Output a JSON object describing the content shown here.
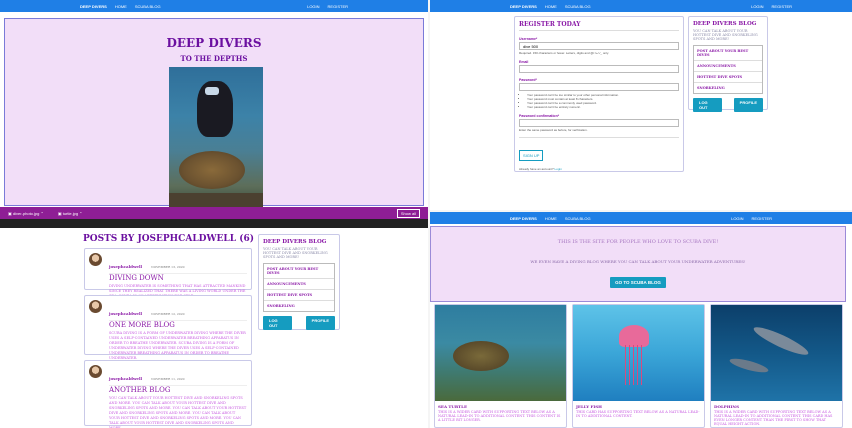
{
  "q1": {
    "nav": {
      "brand": "Deep Divers",
      "links": [
        "Home",
        "Scuba Blog"
      ],
      "right": [
        "Login",
        "Register"
      ]
    },
    "title": "Deep Divers",
    "subtitle": "To the Depths",
    "downloads": [
      "diver-photo.jpg",
      "turtle.jpg"
    ],
    "show_all": "Show all"
  },
  "q2": {
    "nav": {
      "brand": "Deep Divers",
      "links": [
        "Home",
        "Scuba Blog"
      ],
      "right": [
        "Login",
        "Register"
      ]
    },
    "form_title": "Register Today",
    "username_label": "Username*",
    "username_value": "dive 500",
    "username_help": "Required. 150 characters or fewer. Letters, digits and @/./+/-/_ only.",
    "email_label": "Email",
    "password_label": "Password*",
    "password_rules": [
      "Your password can't be too similar to your other personal information.",
      "Your password must contain at least 8 characters.",
      "Your password can't be a commonly used password.",
      "Your password can't be entirely numeric."
    ],
    "confirm_label": "Password confirmation*",
    "confirm_help": "Enter the same password as before, for verification.",
    "signup": "Sign Up",
    "already": "Already have an account?",
    "login_link": "Login",
    "side_title": "Deep Divers Blog",
    "side_text": "You can talk about your hottest dive and snorkeling spots and more!",
    "side_links": [
      "Post about your best dives",
      "Announcements",
      "Hottest Dive Spots",
      "Snorkeling"
    ],
    "side_btns": [
      "Log Out",
      "Profile"
    ]
  },
  "q3": {
    "header": "Posts by josephcaldwell (6)",
    "posts": [
      {
        "author": "josephcaldwell",
        "date": "November 13, 2020",
        "title": "Diving Down",
        "body": "Diving underwater is something that has attracted mankind since they realized that there was a living world under the sea. Scuba is an abbreviation for Self ..."
      },
      {
        "author": "josephcaldwell",
        "date": "November 12, 2020",
        "title": "One More Blog",
        "body": "Scuba diving is a form of underwater diving where the diver uses a self-contained underwater breathing apparatus in order to breathe underwater. Scuba diving is a form of underwater diving where the diver uses a self-contained underwater breathing apparatus in order to breathe underwater."
      },
      {
        "author": "josephcaldwell",
        "date": "November 11, 2020",
        "title": "Another Blog",
        "body": "You can talk about your hottest dive and snorkeling spots and more. You can talk about your hottest dive and snorkeling spots and more. You can talk about your hottest dive and snorkeling spots and more. You can talk about your hottest dive and snorkeling spots and more. You can talk about your hottest dive and snorkeling spots and more."
      }
    ],
    "side_title": "Deep Divers Blog",
    "side_text": "You can talk about your hottest dive and snorkeling spots and more!",
    "side_links": [
      "Post about your best dives",
      "Announcements",
      "Hottest Dive Spots",
      "Snorkeling"
    ],
    "side_btns": [
      "Log Out",
      "Profile"
    ]
  },
  "q4": {
    "nav": {
      "brand": "Deep Divers",
      "links": [
        "Home",
        "Scuba Blog"
      ],
      "right": [
        "Login",
        "Register"
      ]
    },
    "hero_title": "This is the site for people who love to scuba dive!",
    "hero_text": "We even have a diving blog where you can talk about your underwater adventures!",
    "hero_btn": "Go to Scuba Blog",
    "cards": [
      {
        "title": "Sea Turtle",
        "text": "This is a wider card with supporting text below as a natural lead-in to additional content. This content is a little bit longer."
      },
      {
        "title": "Jelly Fish",
        "text": "This card has supporting text below as a natural lead-in to additional content."
      },
      {
        "title": "Dolphins",
        "text": "This is a wider card with supporting text below as a natural lead-in to additional content. This card has even longer content than the first to show that equal height action."
      }
    ]
  }
}
